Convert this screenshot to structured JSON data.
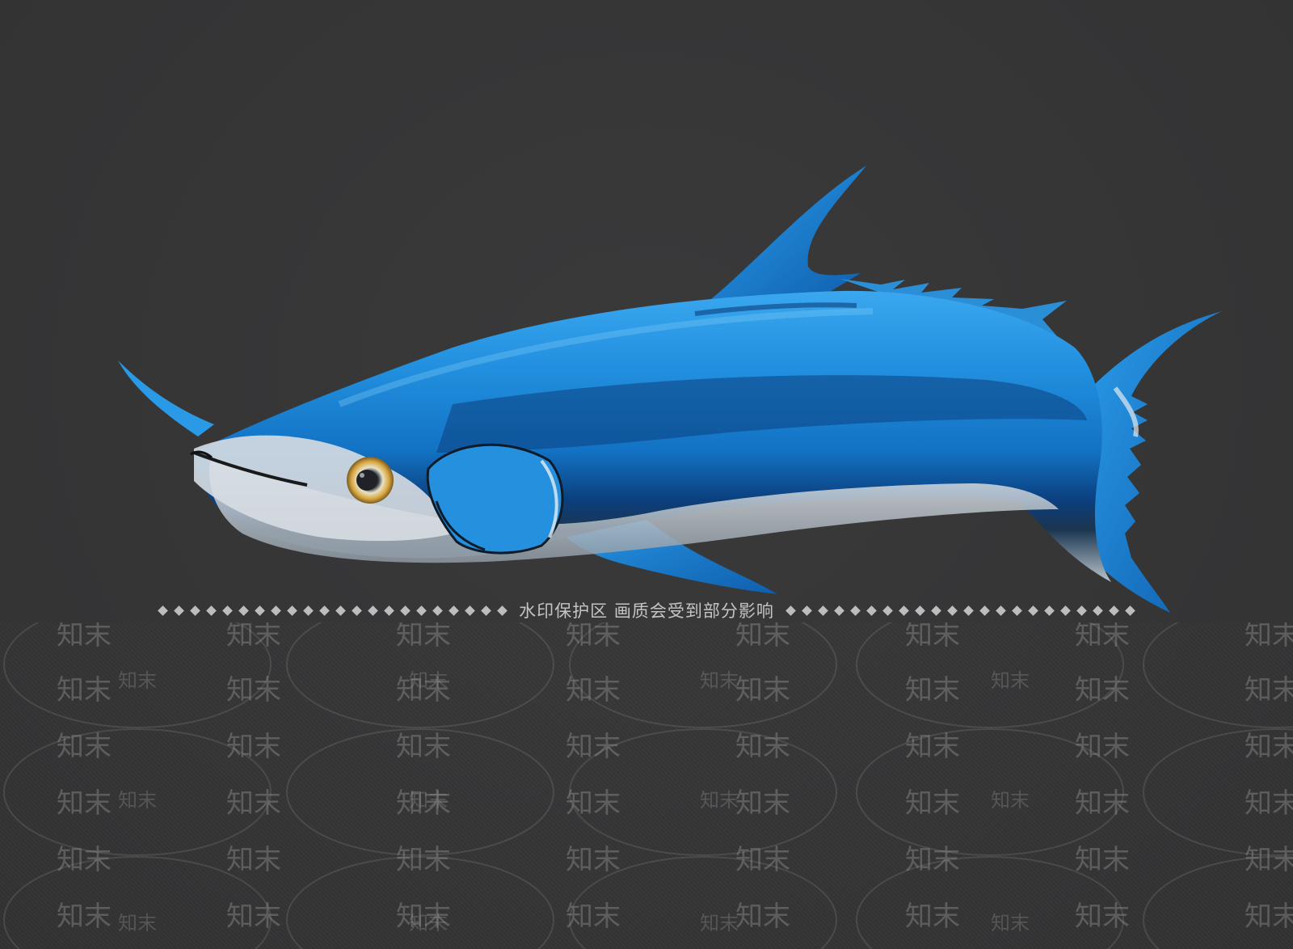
{
  "scene": {
    "subject": "fish-model",
    "colors": {
      "background": "#363637",
      "fish_body": "#1f86d6",
      "fish_dark_stripe": "#0a3d78",
      "fish_belly": "#d8dde2",
      "eye_ring": "#d9a640"
    }
  },
  "watermark_banner": {
    "text": "水印保护区   画质会受到部分影响"
  },
  "watermark": {
    "mark": "知末"
  }
}
